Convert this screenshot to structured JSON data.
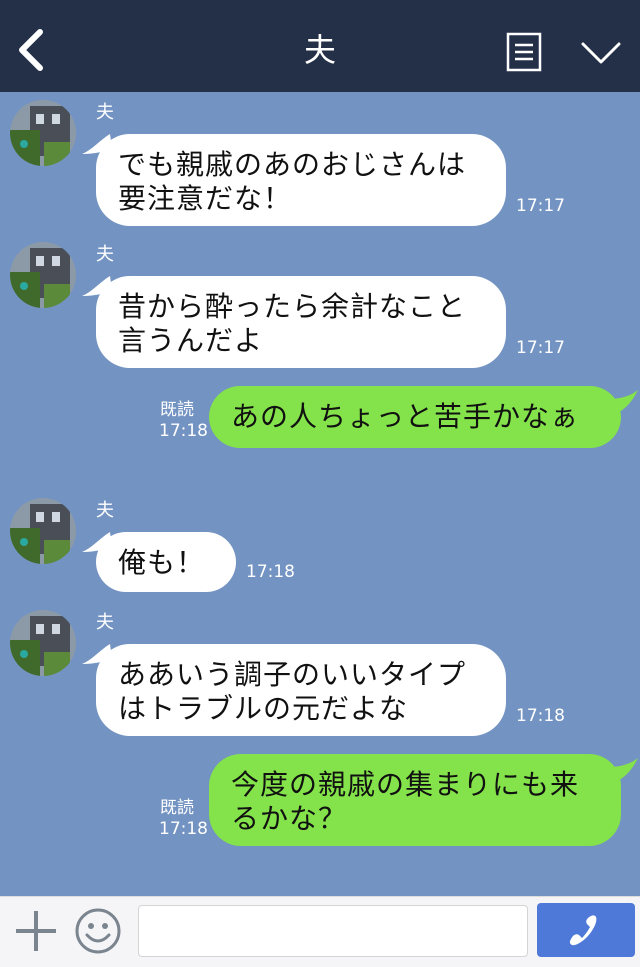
{
  "header": {
    "title": "夫"
  },
  "messages": [
    {
      "dir": "in",
      "sender": "夫",
      "lines": [
        "でも親戚のあのおじさんは",
        "要注意だな！"
      ],
      "time": "17:17"
    },
    {
      "dir": "in",
      "sender": "夫",
      "lines": [
        "昔から酔ったら余計なこと",
        "言うんだよ"
      ],
      "time": "17:17"
    },
    {
      "dir": "out",
      "read": "既読",
      "lines": [
        "あの人ちょっと苦手かなぁ"
      ],
      "time": "17:18"
    },
    {
      "dir": "in",
      "sender": "夫",
      "lines": [
        "俺も！"
      ],
      "time": "17:18"
    },
    {
      "dir": "in",
      "sender": "夫",
      "lines": [
        "ああいう調子のいいタイプ",
        "はトラブルの元だよな"
      ],
      "time": "17:18"
    },
    {
      "dir": "out",
      "read": "既読",
      "lines": [
        "今度の親戚の集まりにも来",
        "るかな？"
      ],
      "time": "17:18"
    }
  ],
  "input": {
    "value": "",
    "placeholder": ""
  },
  "icons": {
    "back": "chevron-left-icon",
    "menu": "menu-list-icon",
    "collapse": "chevron-down-icon",
    "add": "plus-icon",
    "emoji": "smile-icon",
    "call": "phone-icon"
  },
  "colors": {
    "header": "#243048",
    "background": "#7393c2",
    "incoming_bubble": "#ffffff",
    "outgoing_bubble": "#84e24a",
    "call_button": "#4f79d9"
  }
}
